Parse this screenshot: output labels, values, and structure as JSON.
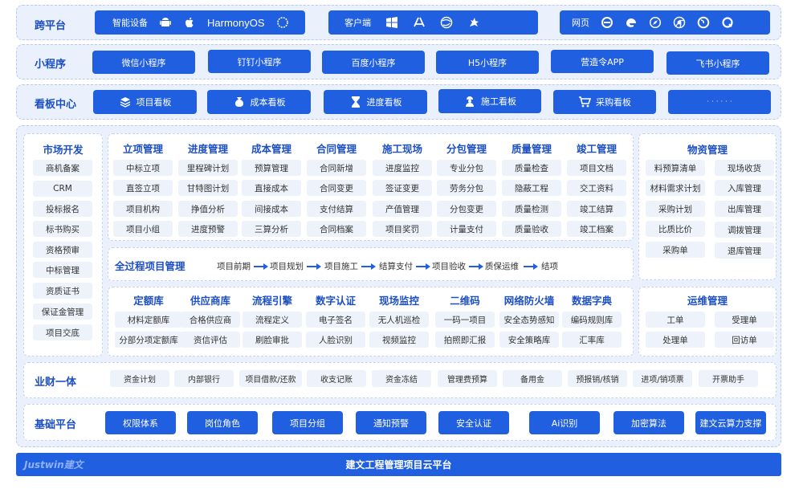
{
  "cross_platform": {
    "title": "跨平台",
    "devices": {
      "label": "智能设备",
      "brand": "HarmonyOS"
    },
    "client": {
      "label": "客户端"
    },
    "web": {
      "label": "网页"
    }
  },
  "mini_programs": {
    "title": "小程序",
    "items": [
      "微信小程序",
      "钉钉小程序",
      "百度小程序",
      "H5小程序",
      "营造令APP",
      "飞书小程序"
    ]
  },
  "dashboard": {
    "title": "看板中心",
    "items": [
      "项目看板",
      "成本看板",
      "进度看板",
      "施工看板",
      "采购看板",
      "· · · · · ·"
    ]
  },
  "market": {
    "title": "市场开发",
    "items": [
      "商机备案",
      "CRM",
      "投标报名",
      "标书购买",
      "资格预审",
      "中标管理",
      "资质证书",
      "保证金管理",
      "项目交底"
    ]
  },
  "modules": [
    {
      "title": "立项管理",
      "items": [
        "中标立项",
        "直签立项",
        "项目机构",
        "项目小组"
      ]
    },
    {
      "title": "进度管理",
      "items": [
        "里程碑计划",
        "甘特图计划",
        "挣值分析",
        "进度预警"
      ]
    },
    {
      "title": "成本管理",
      "items": [
        "预算管理",
        "直接成本",
        "间接成本",
        "三算分析"
      ]
    },
    {
      "title": "合同管理",
      "items": [
        "合同新增",
        "合同变更",
        "支付结算",
        "合同档案"
      ]
    },
    {
      "title": "施工现场",
      "items": [
        "进度监控",
        "签证变更",
        "产值管理",
        "项目奖罚"
      ]
    },
    {
      "title": "分包管理",
      "items": [
        "专业分包",
        "劳务分包",
        "分包变更",
        "计量支付"
      ]
    },
    {
      "title": "质量管理",
      "items": [
        "质量检查",
        "隐蔽工程",
        "质量检测",
        "质量验收"
      ]
    },
    {
      "title": "竣工管理",
      "items": [
        "项目文档",
        "交工资料",
        "竣工结算",
        "竣工档案"
      ]
    }
  ],
  "materials": {
    "title": "物资管理",
    "items": [
      "料预算清单",
      "现场收货",
      "材料需求计划",
      "入库管理",
      "采购计划",
      "出库管理",
      "比质比价",
      "调拨管理",
      "采购单",
      "退库管理"
    ]
  },
  "lifecycle": {
    "title": "全过程项目管理",
    "steps": [
      "项目前期",
      "项目规划",
      "项目施工",
      "结算支付",
      "项目验收",
      "质保运维",
      "结项"
    ]
  },
  "lower_modules": [
    {
      "title": "定额库",
      "items": [
        "材料定额库",
        "分部分项定额库"
      ]
    },
    {
      "title": "供应商库",
      "items": [
        "合格供应商",
        "资信评估"
      ]
    },
    {
      "title": "流程引擎",
      "items": [
        "流程定义",
        "刷脸审批"
      ]
    },
    {
      "title": "数字认证",
      "items": [
        "电子签名",
        "人脸识别"
      ]
    },
    {
      "title": "现场监控",
      "items": [
        "无人机巡检",
        "视频监控"
      ]
    },
    {
      "title": "二维码",
      "items": [
        "一码一项目",
        "拍照即汇报"
      ]
    },
    {
      "title": "网络防火墙",
      "items": [
        "安全态势感知",
        "安全策略库"
      ]
    },
    {
      "title": "数据字典",
      "items": [
        "编码规则库",
        "汇率库"
      ]
    }
  ],
  "ops": {
    "title": "运维管理",
    "items": [
      "工单",
      "受理单",
      "处理单",
      "回访单"
    ]
  },
  "finance": {
    "title": "业财一体",
    "items": [
      "资金计划",
      "内部银行",
      "项目借款/还款",
      "收支记账",
      "资金冻结",
      "管理费预算",
      "备用金",
      "预报销/核销",
      "进项/销项票",
      "开票助手"
    ]
  },
  "base": {
    "title": "基础平台",
    "items": [
      "权限体系",
      "岗位角色",
      "项目分组",
      "通知预警",
      "安全认证",
      "Ai识别",
      "加密算法",
      "建文云算力支撑"
    ]
  },
  "footer": {
    "logo": "Justwin建文",
    "title": "建文工程管理项目云平台"
  },
  "colors": {
    "primary": "#1f5fe0",
    "band": "#eaf1fc",
    "title": "#1d4fc4",
    "light_button": "#eef3fb"
  }
}
